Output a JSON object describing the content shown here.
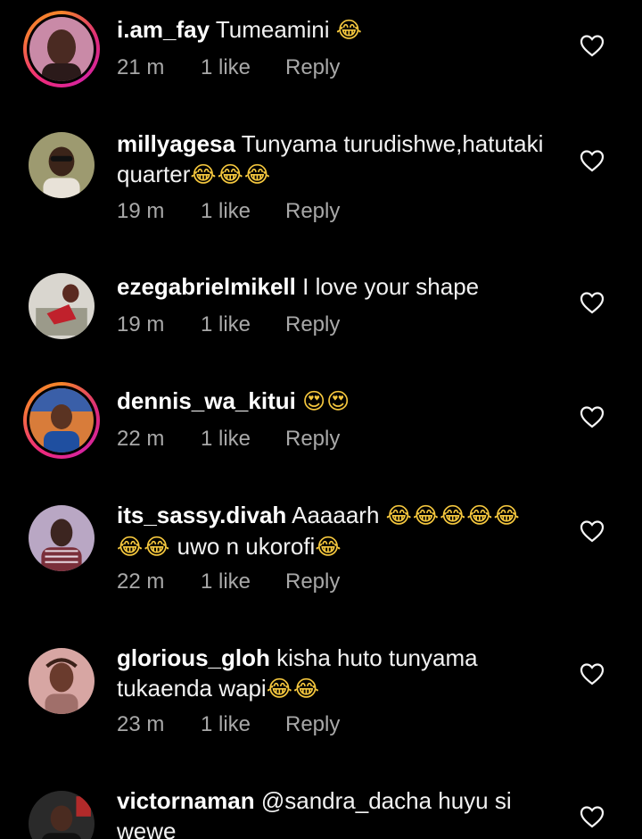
{
  "colors": {
    "background": "#000000",
    "username": "#ffffff",
    "text": "#f2f2f2",
    "meta": "#a8a8a8",
    "emoji": "#f6c83e"
  },
  "icons": {
    "like": "heart-outline-icon",
    "laughing": "face-with-tears-of-joy-icon",
    "heart_eyes": "smiling-face-with-heart-eyes-icon"
  },
  "comments": [
    {
      "username": "i.am_fay",
      "text": "Tumeamini",
      "emoji_a": "😂",
      "emoji_b": "",
      "text2": "",
      "emoji_c": "",
      "time": "21 m",
      "likes": "1 like",
      "reply": "Reply",
      "story_ring": true
    },
    {
      "username": "millyagesa",
      "text": "Tunyama turudishwe,hatutaki quarter",
      "emoji_a": "😂😂😂",
      "emoji_b": "",
      "text2": "",
      "emoji_c": "",
      "time": "19 m",
      "likes": "1 like",
      "reply": "Reply",
      "story_ring": false
    },
    {
      "username": "ezegabrielmikell",
      "text": "I love your shape",
      "emoji_a": "",
      "emoji_b": "",
      "text2": "",
      "emoji_c": "",
      "time": "19 m",
      "likes": "1 like",
      "reply": "Reply",
      "story_ring": false
    },
    {
      "username": "dennis_wa_kitui",
      "text": "",
      "emoji_a": "😍😍",
      "emoji_b": "",
      "text2": "",
      "emoji_c": "",
      "time": "22 m",
      "likes": "1 like",
      "reply": "Reply",
      "story_ring": true
    },
    {
      "username": "its_sassy.divah",
      "text": "Aaaaarh",
      "emoji_a": "😂😂😂😂😂",
      "emoji_b": "😂😂",
      "text2": "uwo n ukorofi",
      "emoji_c": "😂",
      "time": "22 m",
      "likes": "1 like",
      "reply": "Reply",
      "story_ring": false
    },
    {
      "username": "glorious_gloh",
      "text": "kisha huto tunyama tukaenda wapi",
      "emoji_a": "😂😂",
      "emoji_b": "",
      "text2": "",
      "emoji_c": "",
      "time": "23 m",
      "likes": "1 like",
      "reply": "Reply",
      "story_ring": false
    },
    {
      "username": "victornaman",
      "text": "@sandra_dacha huyu si wewe",
      "emoji_a": "",
      "emoji_b": "",
      "text2": "",
      "emoji_c": "",
      "time": "",
      "likes": "",
      "reply": "",
      "story_ring": false
    }
  ]
}
